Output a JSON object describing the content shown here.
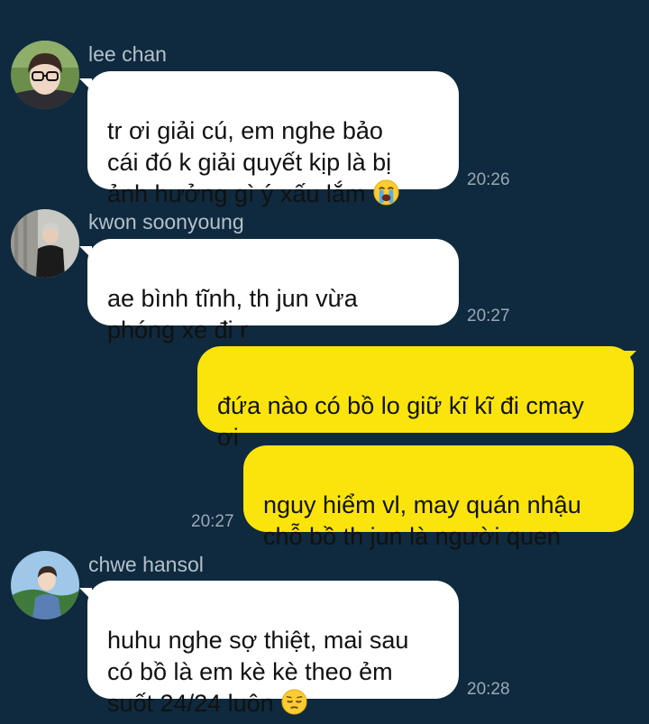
{
  "messages": [
    {
      "sender": "lee chan",
      "avatar_icon": "avatar-lee-chan",
      "text": "tr ơi giải cú, em nghe bảo\ncái đó k giải quyết kịp là bị\nảnh hưởng gì ý xấu lắm",
      "emoji": "loudly-crying-face-icon",
      "time": "20:26"
    },
    {
      "sender": "kwon soonyoung",
      "avatar_icon": "avatar-kwon-soonyoung",
      "text": "ae bình tĩnh, th jun vừa\nphóng xe đi r",
      "time": "20:27"
    },
    {
      "sender": "me",
      "text": "đứa nào có bồ lo giữ kĩ kĩ đi cmay\nơi"
    },
    {
      "sender": "me",
      "text": "nguy hiểm vl, may quán nhậu\nchỗ bồ th jun là người quen",
      "time": "20:27"
    },
    {
      "sender": "chwe hansol",
      "avatar_icon": "avatar-chwe-hansol",
      "text": "huhu nghe sợ thiệt, mai sau\ncó bồ là em kè kè theo ẻm\nsuốt 24/24 luôn",
      "emoji": "pensive-face-icon",
      "time": "20:28"
    }
  ],
  "colors": {
    "background": "#0f2a3e",
    "incoming_bubble": "#ffffff",
    "outgoing_bubble": "#fbe40b",
    "sender_name": "#b4c0ca",
    "timestamp": "#9aa8b4"
  }
}
